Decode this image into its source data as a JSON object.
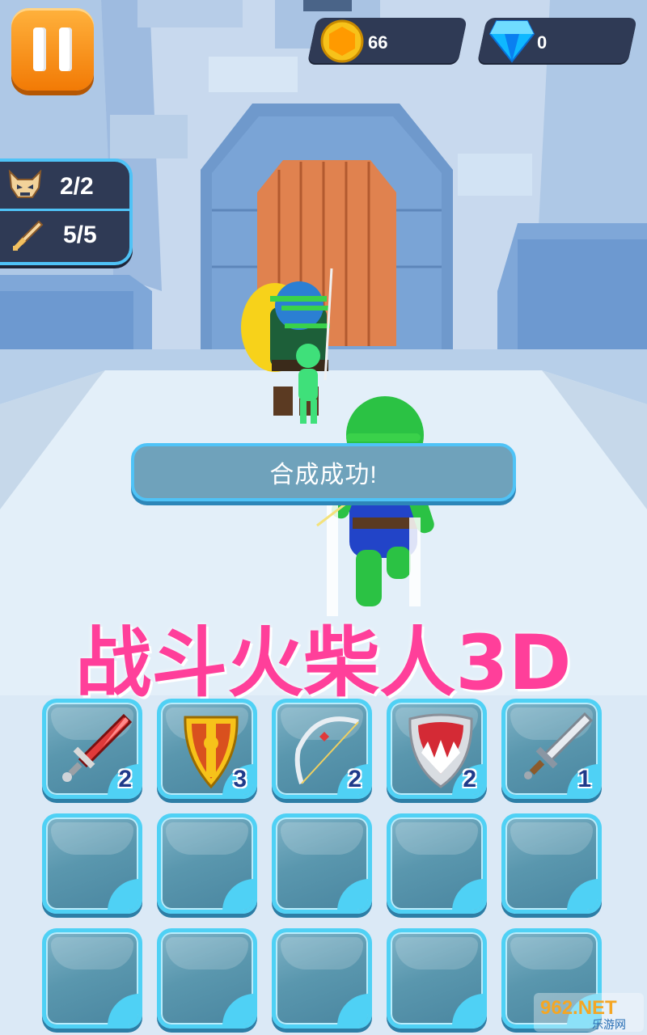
{
  "hud": {
    "coins": "66",
    "gems": "0",
    "enemies": "2/2",
    "weapons": "5/5"
  },
  "toast": "合成成功!",
  "title_banner": "战斗火柴人3D",
  "inventory": [
    {
      "item": "red-sword",
      "level": "2"
    },
    {
      "item": "gold-shield",
      "level": "3"
    },
    {
      "item": "bow",
      "level": "2"
    },
    {
      "item": "red-shield",
      "level": "2"
    },
    {
      "item": "steel-sword",
      "level": "1"
    },
    {
      "item": "",
      "level": ""
    },
    {
      "item": "",
      "level": ""
    },
    {
      "item": "",
      "level": ""
    },
    {
      "item": "",
      "level": ""
    },
    {
      "item": "",
      "level": ""
    },
    {
      "item": "",
      "level": ""
    },
    {
      "item": "",
      "level": ""
    },
    {
      "item": "",
      "level": ""
    },
    {
      "item": "",
      "level": ""
    },
    {
      "item": "",
      "level": ""
    }
  ],
  "watermark": {
    "top": "962.NET",
    "bottom": "乐游网"
  },
  "colors": {
    "accent": "#4fd1f5",
    "title": "#ff3f9a",
    "pause": "#f5890f",
    "hud_bg": "#2f3a55"
  },
  "icons": {
    "pause": "pause-icon",
    "coin": "coin-icon",
    "gem": "gem-icon",
    "enemy": "demon-skull-icon",
    "weapon": "sword-icon"
  }
}
